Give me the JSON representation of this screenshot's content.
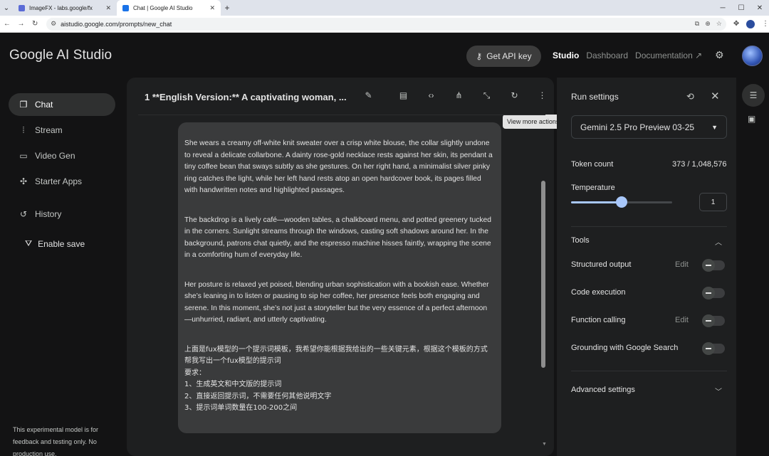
{
  "browser": {
    "tabs": [
      {
        "title": "ImageFX - labs.google/fx",
        "icon": "imagefx-icon",
        "active": false
      },
      {
        "title": "Chat | Google AI Studio",
        "icon": "aistudio-icon",
        "active": true
      }
    ],
    "new_tab": "+",
    "url": "aistudio.google.com/prompts/new_chat",
    "window_controls": {
      "minimize": "─",
      "maximize": "☐",
      "close": "✕"
    }
  },
  "header": {
    "brand": "Google AI Studio",
    "api_key_label": "Get API key",
    "nav": {
      "studio": "Studio",
      "dashboard": "Dashboard",
      "documentation": "Documentation"
    }
  },
  "sidebar": {
    "items": [
      {
        "label": "Chat",
        "icon": "chat-icon",
        "glyph": "❐"
      },
      {
        "label": "Stream",
        "icon": "stream-icon",
        "glyph": "⦙"
      },
      {
        "label": "Video Gen",
        "icon": "video-icon",
        "glyph": "▭"
      },
      {
        "label": "Starter Apps",
        "icon": "apps-icon",
        "glyph": "✣"
      },
      {
        "label": "History",
        "icon": "history-icon",
        "glyph": "↺"
      }
    ],
    "enable_save": "Enable save",
    "footer": "This experimental model is for feedback and testing only. No production use."
  },
  "main": {
    "title": "1 **English Version:** A captivating woman, ...",
    "tooltip": "View more actions",
    "paragraphs": [
      "She wears a creamy off-white knit sweater over a crisp white blouse, the collar slightly undone to reveal a delicate collarbone. A dainty rose-gold necklace rests against her skin, its pendant a tiny coffee bean that sways subtly as she gestures. On her right hand, a minimalist silver pinky ring catches the light, while her left hand rests atop an open hardcover book, its pages filled with handwritten notes and highlighted passages.",
      "The backdrop is a lively café—wooden tables, a chalkboard menu, and potted greenery tucked in the corners. Sunlight streams through the windows, casting soft shadows around her. In the background, patrons chat quietly, and the espresso machine hisses faintly, wrapping the scene in a comforting hum of everyday life.",
      "Her posture is relaxed yet poised, blending urban sophistication with a bookish ease. Whether she’s leaning in to listen or pausing to sip her coffee, her presence feels both engaging and serene. In this moment, she’s not just a storyteller but the very essence of a perfect afternoon—unhurried, radiant, and utterly captivating."
    ],
    "chinese_lines": [
      "上面是fux模型的一个提示词模板，我希望你能根据我给出的一些关键元素，根据这个模板的方式帮我写出一个fux模型的提示词",
      "要求：",
      "1、生成英文和中文版的提示词",
      "2、直接返回提示词，不需要任何其他说明文字",
      "3、提示词单词数量在100-200之间"
    ]
  },
  "run_settings": {
    "title": "Run settings",
    "model": "Gemini 2.5 Pro Preview 03-25",
    "token_label": "Token count",
    "token_value": "373 / 1,048,576",
    "temperature_label": "Temperature",
    "temperature_value": "1",
    "temperature_fraction": 0.5,
    "tools_label": "Tools",
    "tools": [
      {
        "name": "Structured output",
        "edit": "Edit",
        "enabled": false
      },
      {
        "name": "Code execution",
        "edit": "",
        "enabled": false
      },
      {
        "name": "Function calling",
        "edit": "Edit",
        "enabled": false
      },
      {
        "name": "Grounding with Google Search",
        "edit": "",
        "enabled": false
      }
    ],
    "advanced_label": "Advanced settings"
  },
  "colors": {
    "background": "#131314",
    "panel": "#1e1f20",
    "bubble": "#3a3b3c",
    "accent": "#a8c7fa"
  }
}
